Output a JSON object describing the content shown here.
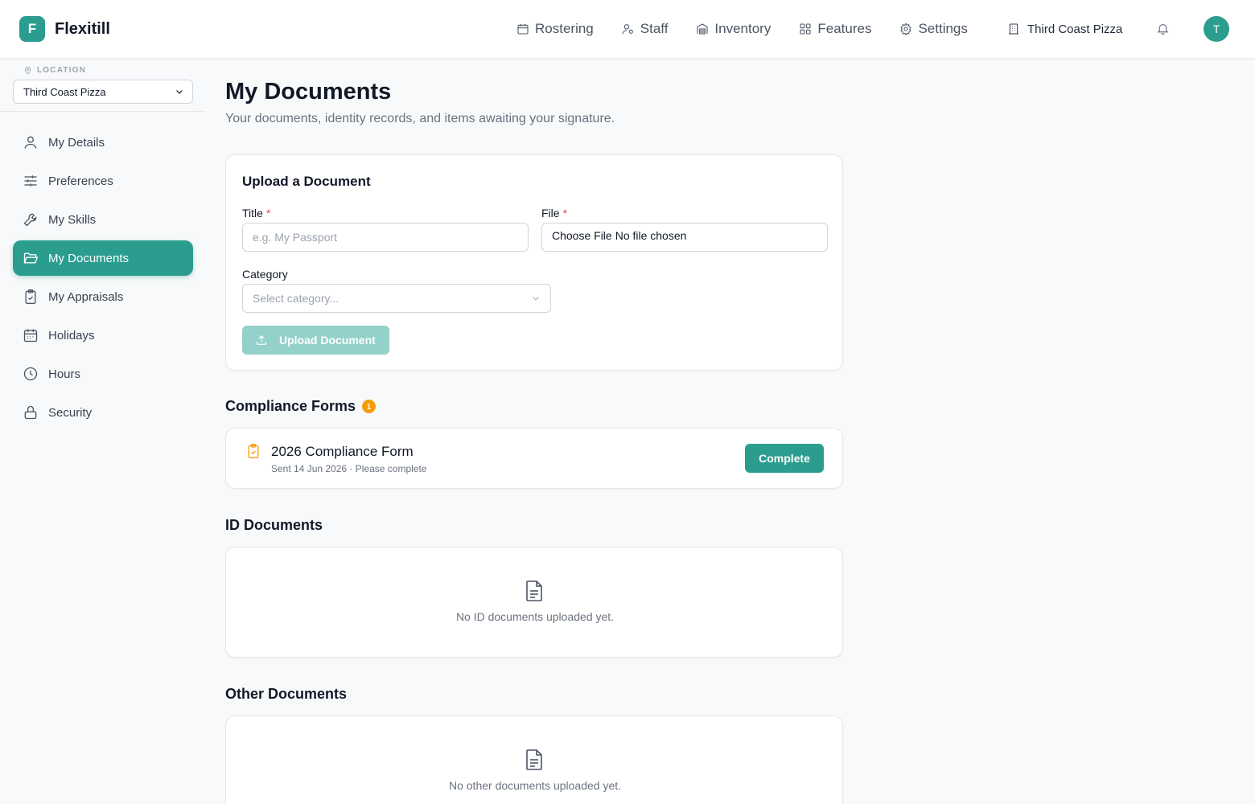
{
  "app": {
    "logo_letter": "F",
    "name": "Flexitill",
    "brand_color": "#2a9d8f"
  },
  "topnav": {
    "items": [
      {
        "label": "Rostering",
        "icon": "calendar-icon"
      },
      {
        "label": "Staff",
        "icon": "user-gear-icon"
      },
      {
        "label": "Inventory",
        "icon": "warehouse-icon"
      },
      {
        "label": "Features",
        "icon": "grid-icon"
      },
      {
        "label": "Settings",
        "icon": "gear-icon"
      }
    ],
    "location": "Third Coast Pizza",
    "avatar_letter": "T"
  },
  "sidebar": {
    "location_label": "LOCATION",
    "location_value": "Third Coast Pizza",
    "items": [
      {
        "label": "My Details",
        "icon": "user-icon",
        "active": false
      },
      {
        "label": "Preferences",
        "icon": "sliders-icon",
        "active": false
      },
      {
        "label": "My Skills",
        "icon": "wrench-icon",
        "active": false
      },
      {
        "label": "My Documents",
        "icon": "folder-open-icon",
        "active": true
      },
      {
        "label": "My Appraisals",
        "icon": "clipboard-check-icon",
        "active": false
      },
      {
        "label": "Holidays",
        "icon": "calendar-days-icon",
        "active": false
      },
      {
        "label": "Hours",
        "icon": "clock-icon",
        "active": false
      },
      {
        "label": "Security",
        "icon": "lock-icon",
        "active": false
      }
    ]
  },
  "page": {
    "title": "My Documents",
    "subtitle": "Your documents, identity records, and items awaiting your signature."
  },
  "upload": {
    "title": "Upload a Document",
    "title_label": "Title",
    "title_placeholder": "e.g. My Passport",
    "file_label": "File",
    "file_button": "Choose File",
    "file_status": "No file chosen",
    "category_label": "Category",
    "category_placeholder": "Select category...",
    "required_mark": "*",
    "button_label": "Upload Document"
  },
  "compliance": {
    "title": "Compliance Forms",
    "count": "1",
    "forms": [
      {
        "name": "2026 Compliance Form",
        "meta": "Sent 14 Jun 2026 · Please complete",
        "action": "Complete"
      }
    ]
  },
  "id_documents": {
    "title": "ID Documents",
    "empty_text": "No ID documents uploaded yet."
  },
  "other_documents": {
    "title": "Other Documents",
    "empty_text": "No other documents uploaded yet."
  }
}
